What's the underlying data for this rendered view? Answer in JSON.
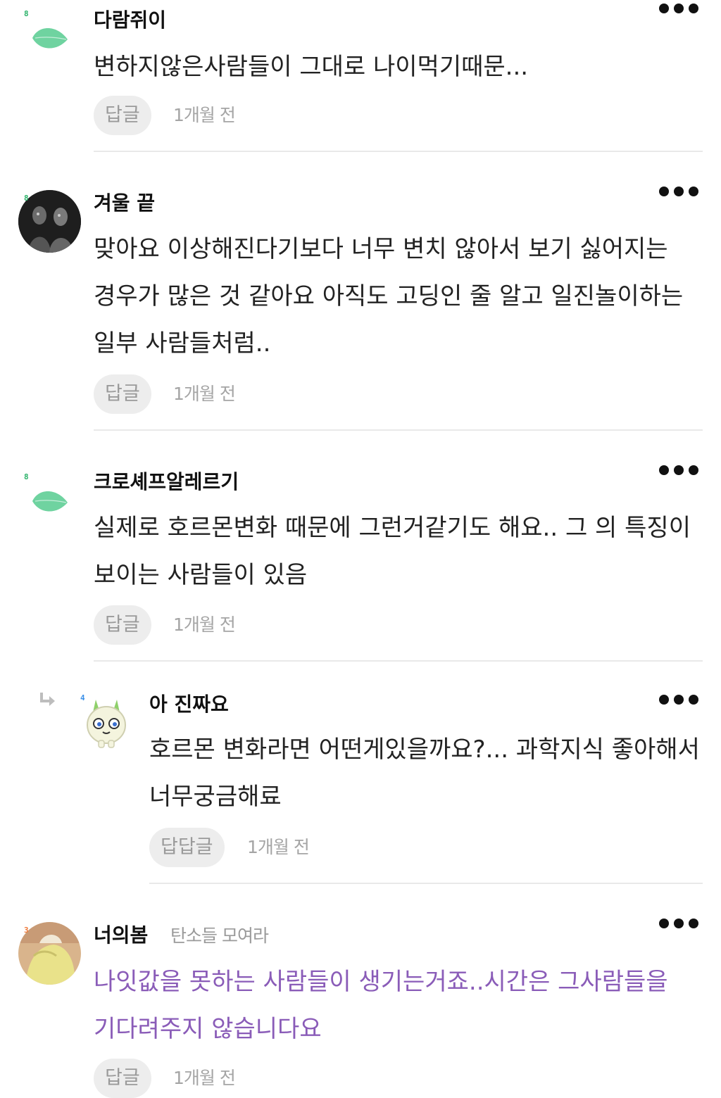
{
  "comments": [
    {
      "author": "다람쥐이",
      "level": "8",
      "avatar": "leaf-icon",
      "text": "변하지않은사람들이 그대로 나이먹기때문...",
      "reply_label": "답글",
      "time": "1개월 전"
    },
    {
      "author": "겨울 끝",
      "level": "8",
      "avatar": "photo-avatar-dark",
      "text": "맞아요 이상해진다기보다 너무 변치 않아서 보기 싫어지는 경우가 많은 것 같아요 아직도 고딩인 줄 알고 일진놀이하는 일부 사람들처럼..",
      "reply_label": "답글",
      "time": "1개월 전"
    },
    {
      "author": "크로셰프알레르기",
      "level": "8",
      "avatar": "leaf-icon",
      "text": "실제로 호르몬변화 때문에 그런거같기도 해요.. 그 의 특징이 보이는 사람들이 있음",
      "reply_label": "답글",
      "time": "1개월 전"
    },
    {
      "author": "아 진짜요",
      "level": "4",
      "avatar": "character-avatar",
      "text": "호르몬 변화라면 어떤게있을까요?... 과학지식 좋아해서 너무궁금해료",
      "reply_label": "답답글",
      "time": "1개월 전"
    },
    {
      "author": "너의봄",
      "level": "3",
      "community": "탄소들 모여라",
      "avatar": "photo-avatar-yellow",
      "text": "나잇값을 못하는 사람들이 생기는거죠..시간은 그사람들을 기다려주지 않습니다요",
      "reply_label": "답글",
      "time": "1개월 전"
    }
  ],
  "colors": {
    "accent_text": "#8a5cb8",
    "leaf_green": "#6fd3a0",
    "level_green": "#2db36b",
    "level_blue": "#3a8fe8",
    "level_orange": "#f07a3a"
  },
  "icons": {
    "more": "more-horizontal-icon",
    "reply_arrow": "reply-arrow-icon"
  }
}
